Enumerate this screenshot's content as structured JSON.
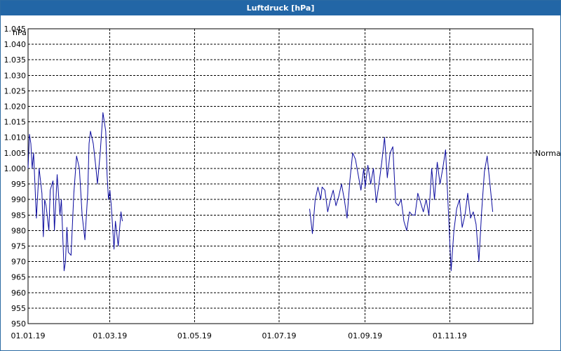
{
  "window": {
    "title": "Luftdruck [hPa]"
  },
  "colors": {
    "titlebar": "#2266a6",
    "line": "#0a0a9e",
    "grid": "#000000"
  },
  "chart_data": {
    "type": "line",
    "title": "Luftdruck [hPa]",
    "ylabel": "hPa",
    "xlabel": "",
    "ylim": [
      950,
      1045
    ],
    "yticks": [
      {
        "v": 950,
        "label": "950"
      },
      {
        "v": 955,
        "label": "955"
      },
      {
        "v": 960,
        "label": "960"
      },
      {
        "v": 965,
        "label": "965"
      },
      {
        "v": 970,
        "label": "970"
      },
      {
        "v": 975,
        "label": "975"
      },
      {
        "v": 980,
        "label": "980"
      },
      {
        "v": 985,
        "label": "985"
      },
      {
        "v": 990,
        "label": "990"
      },
      {
        "v": 995,
        "label": "995"
      },
      {
        "v": 1000,
        "label": "1.000"
      },
      {
        "v": 1005,
        "label": "1.005"
      },
      {
        "v": 1010,
        "label": "1.010"
      },
      {
        "v": 1015,
        "label": "1.015"
      },
      {
        "v": 1020,
        "label": "1.020"
      },
      {
        "v": 1025,
        "label": "1.025"
      },
      {
        "v": 1030,
        "label": "1.030"
      },
      {
        "v": 1035,
        "label": "1.035"
      },
      {
        "v": 1040,
        "label": "1.040"
      },
      {
        "v": 1045,
        "label": "1.045"
      }
    ],
    "xlim": [
      "2019-01-01",
      "2019-12-31"
    ],
    "xticks": [
      {
        "date": "2019-01-01",
        "label": "01.01.19"
      },
      {
        "date": "2019-03-01",
        "label": "01.03.19"
      },
      {
        "date": "2019-05-01",
        "label": "01.05.19"
      },
      {
        "date": "2019-07-01",
        "label": "01.07.19"
      },
      {
        "date": "2019-09-01",
        "label": "01.09.19"
      },
      {
        "date": "2019-11-01",
        "label": "01.11.19"
      }
    ],
    "grid": true,
    "reference_line": {
      "label": "Normal",
      "value": 1005
    },
    "series": [
      {
        "segments": [
          [
            [
              "2019-01-01",
              1000
            ],
            [
              "2019-01-02",
              1011
            ],
            [
              "2019-01-03",
              1008
            ],
            [
              "2019-01-04",
              1000
            ],
            [
              "2019-01-05",
              1005
            ],
            [
              "2019-01-07",
              984
            ],
            [
              "2019-01-09",
              1000
            ],
            [
              "2019-01-11",
              992
            ],
            [
              "2019-01-12",
              978
            ],
            [
              "2019-01-13",
              990
            ],
            [
              "2019-01-14",
              988
            ],
            [
              "2019-01-16",
              980
            ],
            [
              "2019-01-17",
              993
            ],
            [
              "2019-01-19",
              996
            ],
            [
              "2019-01-20",
              980
            ],
            [
              "2019-01-22",
              998
            ],
            [
              "2019-01-24",
              985
            ],
            [
              "2019-01-25",
              990
            ],
            [
              "2019-01-27",
              967
            ],
            [
              "2019-01-28",
              970
            ],
            [
              "2019-01-29",
              981
            ],
            [
              "2019-01-30",
              973
            ],
            [
              "2019-02-01",
              972
            ],
            [
              "2019-02-03",
              992
            ],
            [
              "2019-02-05",
              1004
            ],
            [
              "2019-02-07",
              1000
            ],
            [
              "2019-02-09",
              985
            ],
            [
              "2019-02-11",
              977
            ],
            [
              "2019-02-13",
              992
            ],
            [
              "2019-02-14",
              1008
            ],
            [
              "2019-02-15",
              1012
            ],
            [
              "2019-02-17",
              1008
            ],
            [
              "2019-02-19",
              1000
            ],
            [
              "2019-02-20",
              995
            ],
            [
              "2019-02-22",
              1005
            ],
            [
              "2019-02-24",
              1018
            ],
            [
              "2019-02-26",
              1012
            ],
            [
              "2019-02-27",
              998
            ],
            [
              "2019-02-28",
              990
            ],
            [
              "2019-03-01",
              993
            ],
            [
              "2019-03-02",
              988
            ],
            [
              "2019-03-04",
              974
            ],
            [
              "2019-03-05",
              983
            ],
            [
              "2019-03-07",
              975
            ],
            [
              "2019-03-09",
              986
            ],
            [
              "2019-03-10",
              983
            ]
          ],
          [
            [
              "2019-07-23",
              987
            ],
            [
              "2019-07-25",
              979
            ],
            [
              "2019-07-27",
              990
            ],
            [
              "2019-07-29",
              994
            ],
            [
              "2019-07-31",
              990
            ],
            [
              "2019-08-01",
              994
            ],
            [
              "2019-08-03",
              993
            ],
            [
              "2019-08-05",
              986
            ],
            [
              "2019-08-07",
              990
            ],
            [
              "2019-08-09",
              993
            ],
            [
              "2019-08-11",
              988
            ],
            [
              "2019-08-13",
              991
            ],
            [
              "2019-08-15",
              995
            ],
            [
              "2019-08-17",
              990
            ],
            [
              "2019-08-19",
              984
            ],
            [
              "2019-08-21",
              996
            ],
            [
              "2019-08-23",
              1005
            ],
            [
              "2019-08-25",
              1003
            ],
            [
              "2019-08-27",
              998
            ],
            [
              "2019-08-29",
              993
            ],
            [
              "2019-08-31",
              1000
            ],
            [
              "2019-09-01",
              994
            ],
            [
              "2019-09-03",
              1001
            ],
            [
              "2019-09-05",
              995
            ],
            [
              "2019-09-07",
              1000
            ],
            [
              "2019-09-09",
              989
            ],
            [
              "2019-09-11",
              995
            ],
            [
              "2019-09-13",
              1002
            ],
            [
              "2019-09-15",
              1010
            ],
            [
              "2019-09-17",
              997
            ],
            [
              "2019-09-19",
              1005
            ],
            [
              "2019-09-21",
              1007
            ],
            [
              "2019-09-23",
              989
            ],
            [
              "2019-09-25",
              988
            ],
            [
              "2019-09-27",
              990
            ],
            [
              "2019-09-29",
              983
            ],
            [
              "2019-10-01",
              980
            ],
            [
              "2019-10-03",
              986
            ],
            [
              "2019-10-05",
              985
            ],
            [
              "2019-10-07",
              985
            ],
            [
              "2019-10-09",
              992
            ],
            [
              "2019-10-11",
              989
            ],
            [
              "2019-10-13",
              986
            ],
            [
              "2019-10-15",
              990
            ],
            [
              "2019-10-17",
              985
            ],
            [
              "2019-10-19",
              1000
            ],
            [
              "2019-10-21",
              990
            ],
            [
              "2019-10-23",
              1002
            ],
            [
              "2019-10-25",
              995
            ],
            [
              "2019-10-27",
              1000
            ],
            [
              "2019-10-29",
              1006
            ],
            [
              "2019-11-02",
              967
            ],
            [
              "2019-11-04",
              980
            ],
            [
              "2019-11-06",
              987
            ],
            [
              "2019-11-08",
              990
            ],
            [
              "2019-11-10",
              981
            ],
            [
              "2019-11-12",
              985
            ],
            [
              "2019-11-14",
              992
            ],
            [
              "2019-11-16",
              984
            ],
            [
              "2019-11-18",
              986
            ],
            [
              "2019-11-20",
              982
            ],
            [
              "2019-11-22",
              970
            ],
            [
              "2019-11-24",
              986
            ],
            [
              "2019-11-26",
              999
            ],
            [
              "2019-11-28",
              1004
            ],
            [
              "2019-11-30",
              995
            ],
            [
              "2019-12-02",
              986
            ]
          ]
        ]
      }
    ]
  }
}
